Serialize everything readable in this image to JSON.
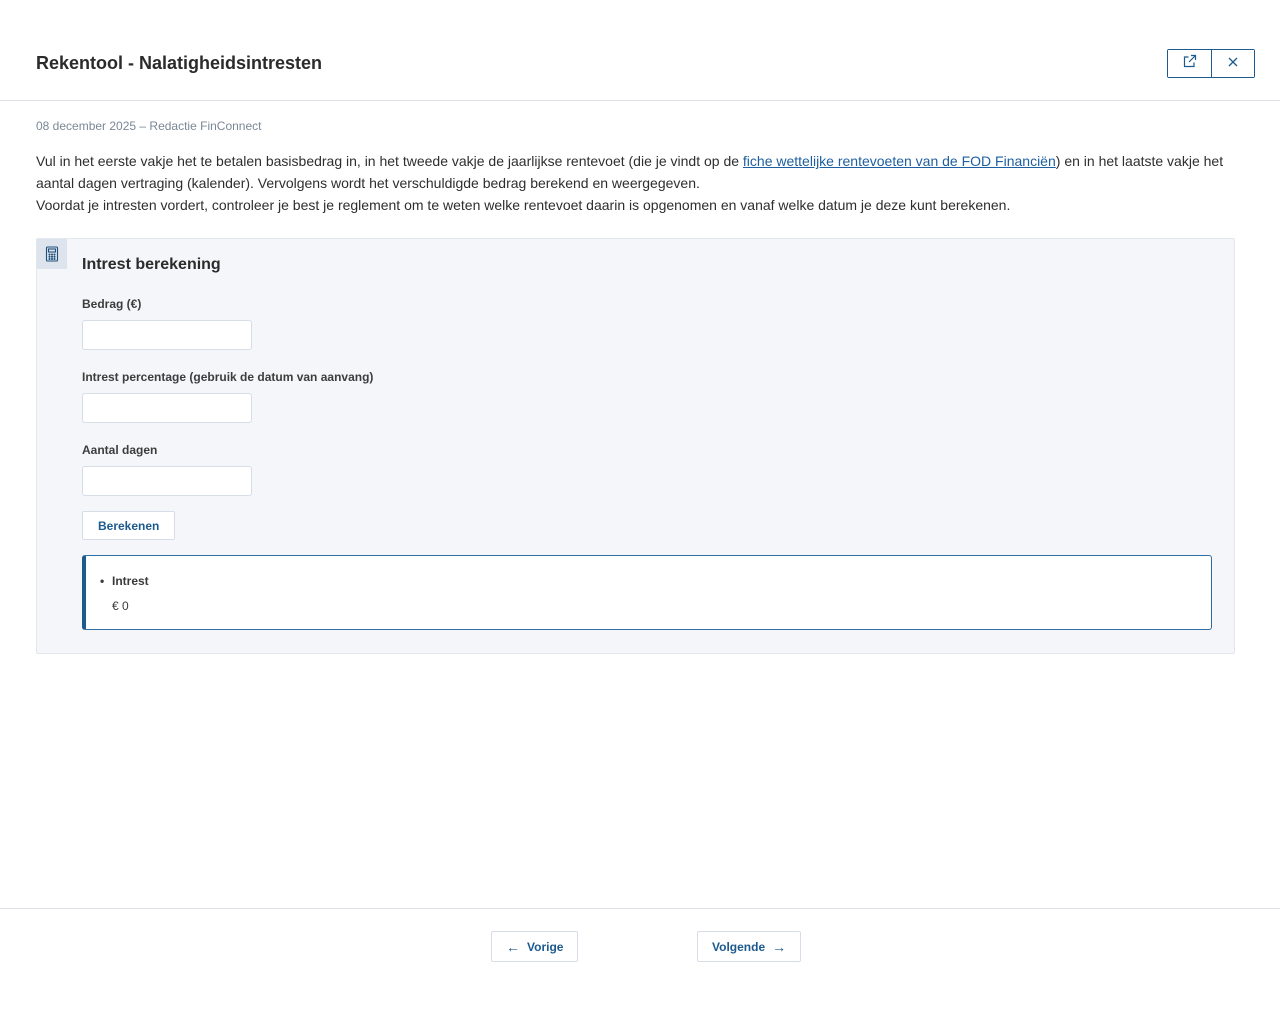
{
  "header": {
    "title": "Rekentool - Nalatigheidsintresten",
    "open_icon": "external-link-icon",
    "close_icon": "close-icon"
  },
  "meta": "08 december 2025 – Redactie FinConnect",
  "intro": {
    "line1_before": "Vul in het eerste vakje het te betalen basisbedrag in, in het tweede vakje de jaarlijkse rentevoet (die je vindt op de ",
    "link_text": "fiche wettelijke rentevoeten van de FOD Financiën",
    "line1_after": ") en in het laatste vakje het aantal dagen vertraging (kalender). Vervolgens wordt het verschuldigde bedrag berekend en weergegeven.",
    "line2": "Voordat je intresten vordert, controleer je best je reglement om te weten welke rentevoet daarin is opgenomen en vanaf welke datum je deze kunt berekenen."
  },
  "calculator": {
    "icon": "calculator-icon",
    "title": "Intrest berekening",
    "fields": [
      {
        "label": "Bedrag (€)",
        "value": ""
      },
      {
        "label": "Intrest percentage (gebruik de datum van aanvang)",
        "value": ""
      },
      {
        "label": "Aantal dagen",
        "value": ""
      }
    ],
    "button_label": "Berekenen",
    "result": {
      "bullet": "•",
      "label": "Intrest",
      "value": "€ 0"
    }
  },
  "footer": {
    "prev_arrow": "←",
    "prev_label": "Vorige",
    "next_label": "Volgende",
    "next_arrow": "→"
  },
  "colors": {
    "accent": "#1d5a8e",
    "link": "#1d5fa0",
    "card_background": "#f4f6f9",
    "meta_text": "#7a8896"
  }
}
